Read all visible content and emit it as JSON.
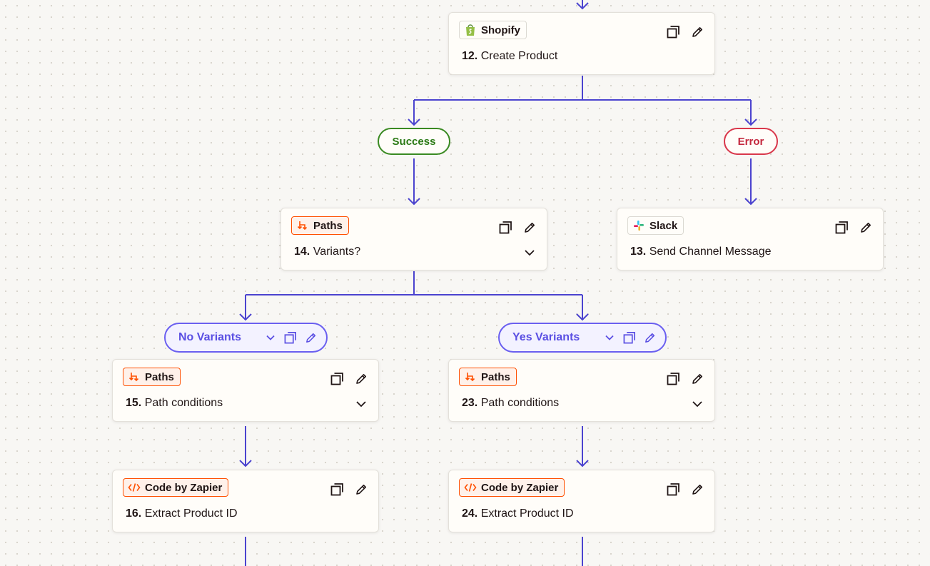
{
  "steps": {
    "s12": {
      "app": "Shopify",
      "number": "12.",
      "title": "Create Product",
      "icon": "shopify-icon"
    },
    "s14": {
      "app": "Paths",
      "number": "14.",
      "title": "Variants?",
      "icon": "paths-icon"
    },
    "s13": {
      "app": "Slack",
      "number": "13.",
      "title": "Send Channel Message",
      "icon": "slack-icon"
    },
    "s15": {
      "app": "Paths",
      "number": "15.",
      "title": "Path conditions",
      "icon": "paths-icon"
    },
    "s23": {
      "app": "Paths",
      "number": "23.",
      "title": "Path conditions",
      "icon": "paths-icon"
    },
    "s16": {
      "app": "Code by Zapier",
      "number": "16.",
      "title": "Extract Product ID",
      "icon": "code-icon"
    },
    "s24": {
      "app": "Code by Zapier",
      "number": "24.",
      "title": "Extract Product ID",
      "icon": "code-icon"
    }
  },
  "outcomes": {
    "success": {
      "label": "Success",
      "color": "#3a8a22"
    },
    "error": {
      "label": "Error",
      "color": "#d9374b"
    }
  },
  "branches": {
    "no_variants": {
      "label": "No Variants"
    },
    "yes_variants": {
      "label": "Yes Variants"
    }
  },
  "colors": {
    "connector": "#4b43cf",
    "branch": "#6a5ff0",
    "accent": "#ff4f00",
    "background": "#f8f7f4"
  }
}
